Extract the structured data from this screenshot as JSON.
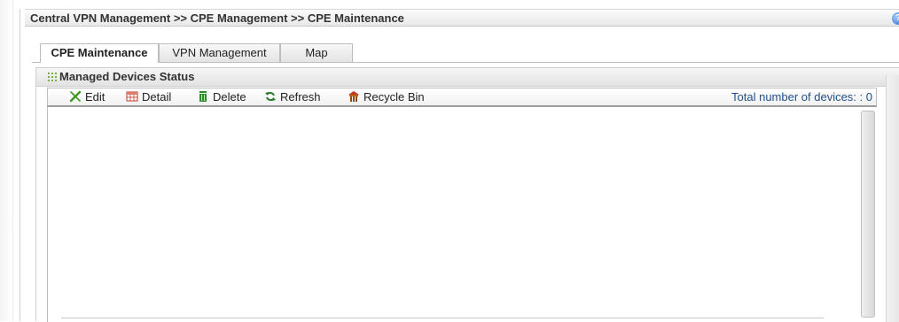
{
  "breadcrumb": "Central VPN Management >> CPE Management >> CPE Maintenance",
  "help_icon": "question-icon",
  "tabs": [
    {
      "label": "CPE Maintenance",
      "active": true
    },
    {
      "label": "VPN Management",
      "active": false
    },
    {
      "label": "Map",
      "active": false
    }
  ],
  "panel": {
    "title": "Managed Devices Status",
    "title_icon": "grip-dots-icon"
  },
  "toolbar": {
    "edit_label": "Edit",
    "detail_label": "Detail",
    "delete_label": "Delete",
    "refresh_label": "Refresh",
    "recycle_label": "Recycle Bin",
    "total_label": "Total number of devices: : 0"
  },
  "colors": {
    "accent_green": "#3a9a1c",
    "link_blue": "#1f4f8a",
    "delete_green": "#2e8b2e",
    "recycle_brown": "#b5651d"
  }
}
